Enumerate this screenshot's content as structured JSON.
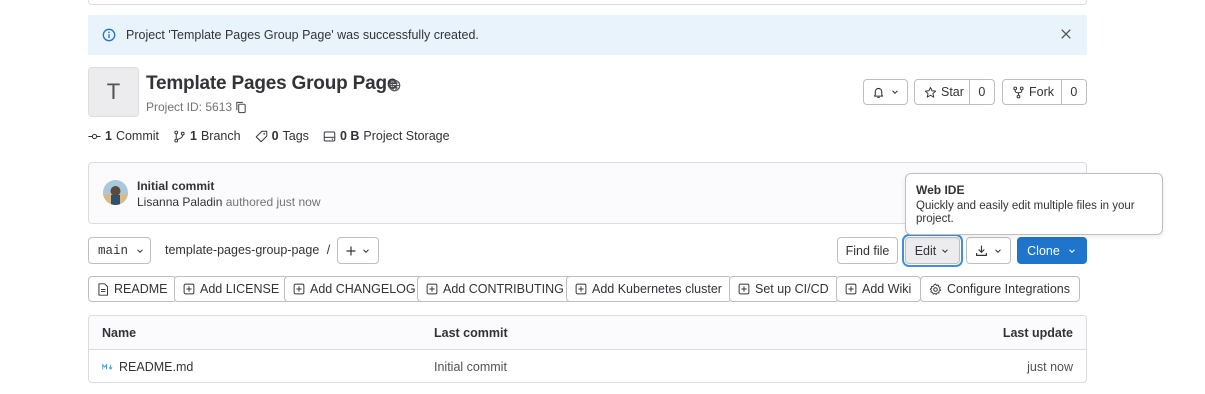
{
  "alert": {
    "message": "Project 'Template Pages Group Page' was successfully created."
  },
  "project": {
    "avatar_letter": "T",
    "title": "Template Pages Group Page",
    "id_text": "Project ID: 5613"
  },
  "actions": {
    "star_label": "Star",
    "star_count": "0",
    "fork_label": "Fork",
    "fork_count": "0"
  },
  "stats": [
    {
      "value": "1",
      "label": "Commit"
    },
    {
      "value": "1",
      "label": "Branch"
    },
    {
      "value": "0",
      "label": "Tags"
    },
    {
      "value": "0 B",
      "label": "Project Storage"
    }
  ],
  "last_commit": {
    "title": "Initial commit",
    "author": "Lisanna Paladin",
    "meta": "authored just now"
  },
  "tooltip": {
    "title": "Web IDE",
    "body": "Quickly and easily edit multiple files in your project."
  },
  "repo_toolbar": {
    "branch": "main",
    "path": "template-pages-group-page",
    "path_sep": "/",
    "find_file": "Find file",
    "edit": "Edit",
    "clone": "Clone"
  },
  "quick_actions": [
    {
      "label": "README",
      "icon": "doc-icon"
    },
    {
      "label": "Add LICENSE",
      "icon": "plus-square-icon"
    },
    {
      "label": "Add CHANGELOG",
      "icon": "plus-square-icon"
    },
    {
      "label": "Add CONTRIBUTING",
      "icon": "plus-square-icon"
    },
    {
      "label": "Add Kubernetes cluster",
      "icon": "plus-square-icon"
    },
    {
      "label": "Set up CI/CD",
      "icon": "plus-square-icon"
    },
    {
      "label": "Add Wiki",
      "icon": "plus-square-icon"
    },
    {
      "label": "Configure Integrations",
      "icon": "gear-icon"
    }
  ],
  "file_table": {
    "headers": {
      "name": "Name",
      "last_commit": "Last commit",
      "last_update": "Last update"
    },
    "rows": [
      {
        "name": "README.md",
        "last_commit": "Initial commit",
        "last_update": "just now"
      }
    ]
  },
  "colors": {
    "primary": "#1f75cb",
    "alert_bg": "#e9f3fc",
    "text": "#333238",
    "muted": "#737278"
  }
}
